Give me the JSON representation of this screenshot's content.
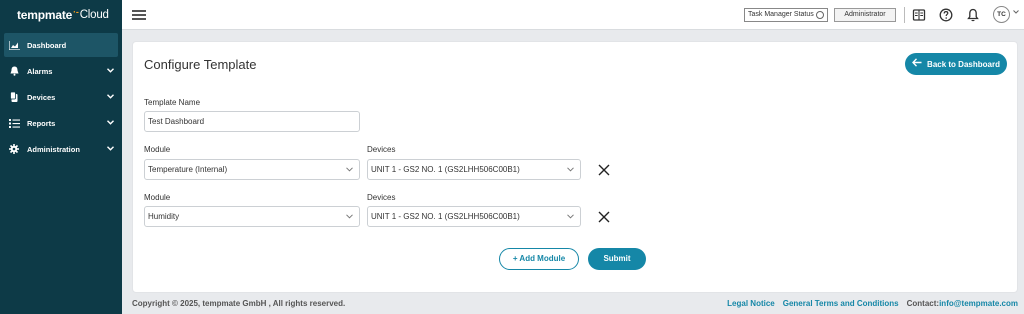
{
  "app": {
    "logo_brand": "tempmate",
    "logo_suffix": "Cloud",
    "logo_dot": "·-"
  },
  "sidebar": {
    "items": [
      {
        "label": "Dashboard",
        "icon": "chart-icon",
        "active": true
      },
      {
        "label": "Alarms",
        "icon": "bell-icon",
        "has_chevron": true
      },
      {
        "label": "Devices",
        "icon": "device-icon",
        "has_chevron": true
      },
      {
        "label": "Reports",
        "icon": "list-icon",
        "has_chevron": true
      },
      {
        "label": "Administration",
        "icon": "gear-icon",
        "has_chevron": true
      }
    ]
  },
  "header": {
    "task_manager_label": "Task Manager Status",
    "role_label": "Administrator",
    "avatar_initials": "TC",
    "icons": [
      "book-icon",
      "help-icon",
      "notification-bell-icon"
    ]
  },
  "page": {
    "title": "Configure Template",
    "back_button": "Back to Dashboard",
    "template_name_label": "Template Name",
    "template_name_value": "Test Dashboard",
    "rows": [
      {
        "module_label": "Module",
        "module_value": "Temperature (Internal)",
        "devices_label": "Devices",
        "devices_value": "UNIT 1 - GS2 NO. 1 (GS2LHH506C00B1)"
      },
      {
        "module_label": "Module",
        "module_value": "Humidity",
        "devices_label": "Devices",
        "devices_value": "UNIT 1 - GS2 NO. 1 (GS2LHH506C00B1)"
      }
    ],
    "add_module_button": "+ Add Module",
    "submit_button": "Submit"
  },
  "footer": {
    "copyright": "Copyright © 2025, tempmate GmbH , All rights reserved.",
    "legal": "Legal Notice",
    "terms": "General Terms and Conditions",
    "contact_label": "Contact: ",
    "contact_email": "info@tempmate.com"
  },
  "colors": {
    "sidebar_bg": "#0d3a47",
    "accent": "#1587a7",
    "logo_dot": "#f39c1f"
  }
}
